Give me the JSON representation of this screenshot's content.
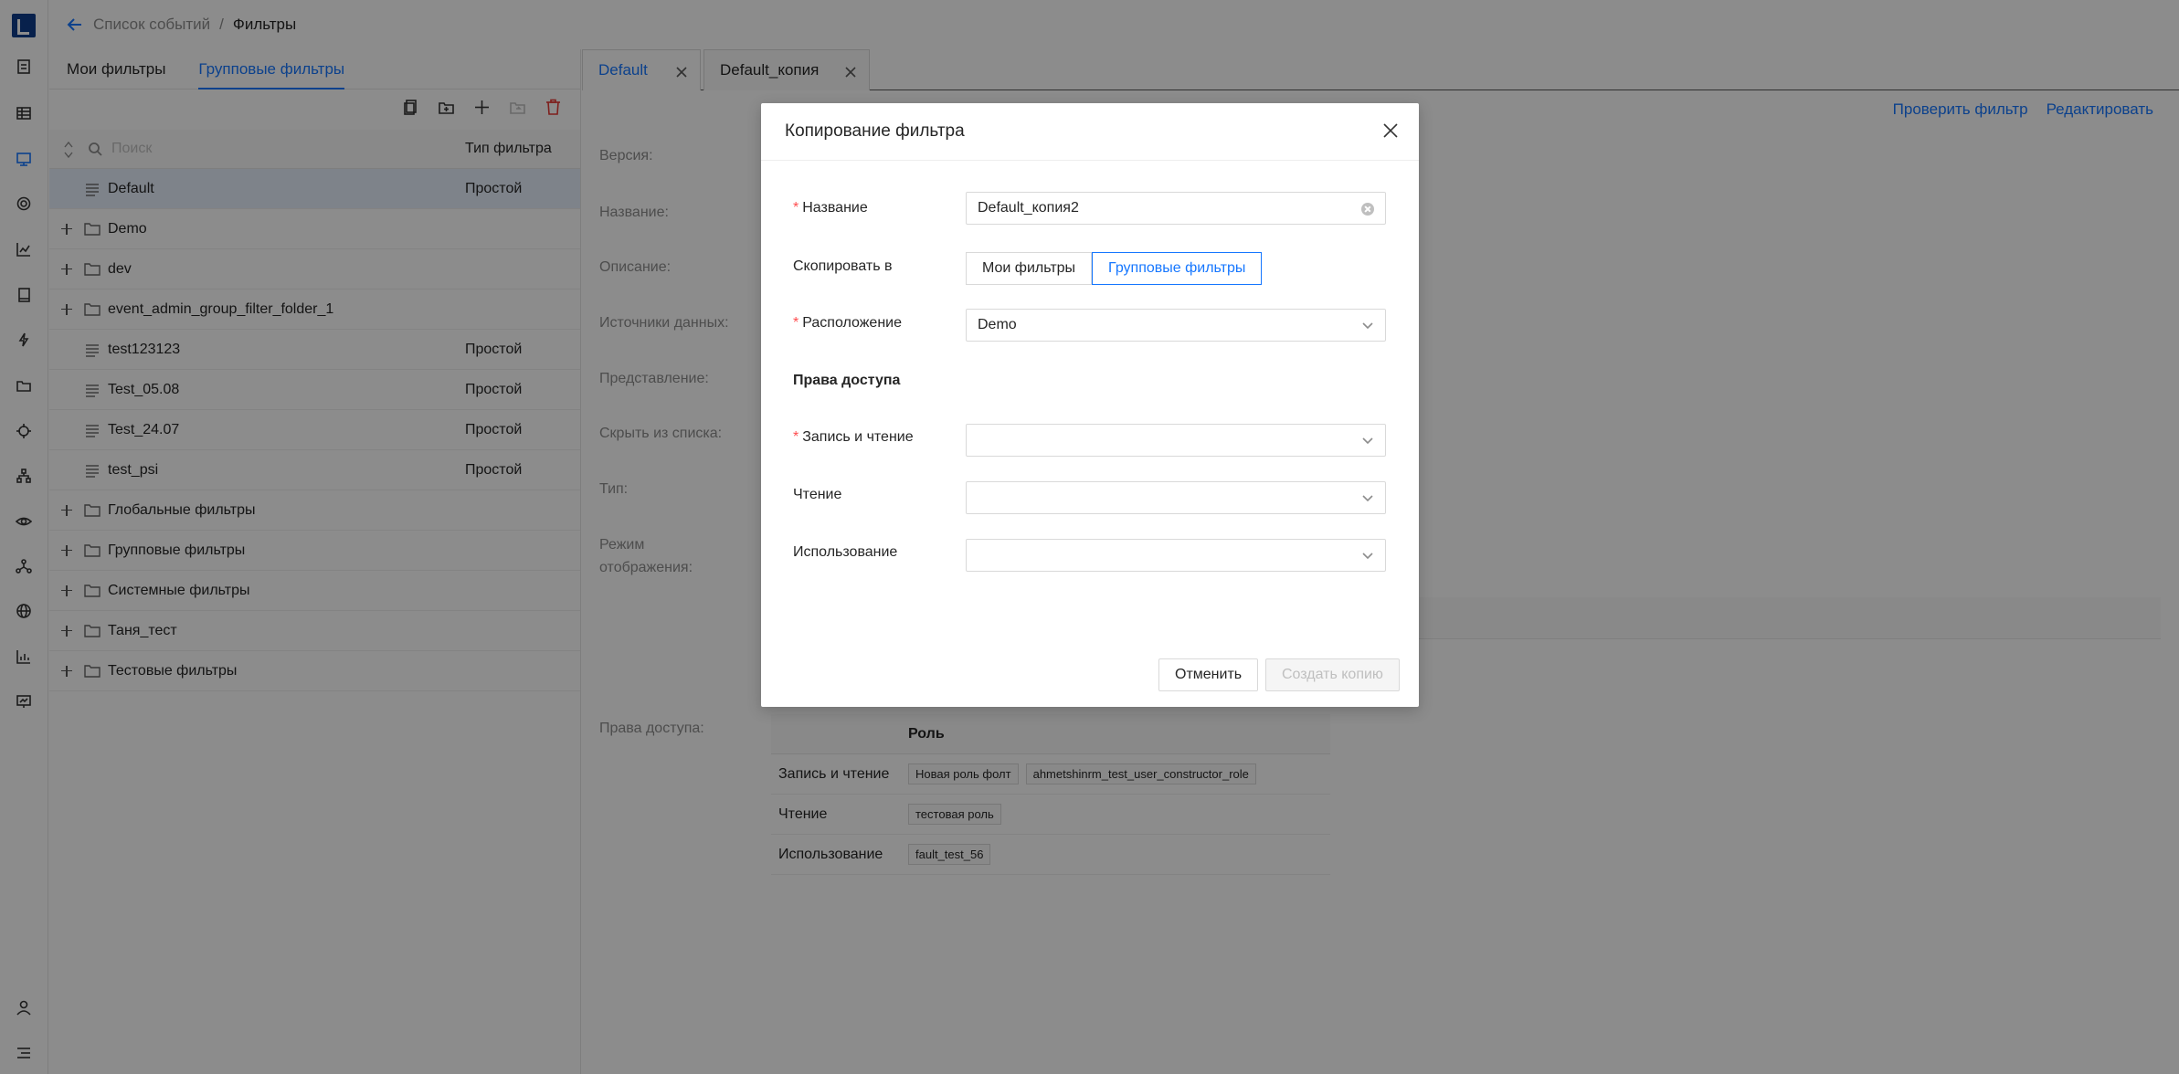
{
  "breadcrumb": {
    "parent": "Список событий",
    "current": "Фильтры"
  },
  "rail_icons": [
    "logo",
    "document-icon",
    "table-icon",
    "monitor-icon",
    "gear-icon",
    "chart-icon",
    "book-icon",
    "lightning-icon",
    "folder-icon",
    "target-icon",
    "hierarchy-icon",
    "eye-icon",
    "network-icon",
    "globe-icon",
    "bar-chart-icon",
    "presentation-icon",
    "user-icon",
    "menu-icon"
  ],
  "left": {
    "tabs": [
      "Мои фильтры",
      "Групповые фильтры"
    ],
    "active_tab": 1,
    "search_placeholder": "Поиск",
    "col_type": "Тип фильтра",
    "rows": [
      {
        "name": "Default",
        "type": "Простой",
        "kind": "filter",
        "selected": true
      },
      {
        "name": "Demo",
        "type": "",
        "kind": "folder"
      },
      {
        "name": "dev",
        "type": "",
        "kind": "folder"
      },
      {
        "name": "event_admin_group_filter_folder_1",
        "type": "",
        "kind": "folder"
      },
      {
        "name": "test123123",
        "type": "Простой",
        "kind": "filter"
      },
      {
        "name": "Test_05.08",
        "type": "Простой",
        "kind": "filter"
      },
      {
        "name": "Test_24.07",
        "type": "Простой",
        "kind": "filter"
      },
      {
        "name": "test_psi",
        "type": "Простой",
        "kind": "filter"
      },
      {
        "name": "Глобальные фильтры",
        "type": "",
        "kind": "folder"
      },
      {
        "name": "Групповые фильтры",
        "type": "",
        "kind": "folder"
      },
      {
        "name": "Системные фильтры",
        "type": "",
        "kind": "folder"
      },
      {
        "name": "Таня_тест",
        "type": "",
        "kind": "folder"
      },
      {
        "name": "Тестовые фильтры",
        "type": "",
        "kind": "folder"
      }
    ]
  },
  "right": {
    "tabs": [
      "Default",
      "Default_копия"
    ],
    "actions": {
      "check": "Проверить фильтр",
      "edit": "Редактировать"
    },
    "labels": {
      "version": "Версия:",
      "name": "Название:",
      "description": "Описание:",
      "sources": "Источники данных:",
      "view": "Представление:",
      "hide": "Скрыть из списка:",
      "type": "Тип:",
      "mode_1": "Режим",
      "mode_2": "отображения:",
      "access": "Права доступа:"
    },
    "access_table": {
      "header": "Роль",
      "rows": [
        {
          "label": "Запись и чтение",
          "tags": [
            "Новая роль фолт",
            "ahmetshinrm_test_user_constructor_role"
          ]
        },
        {
          "label": "Чтение",
          "tags": [
            "тестовая роль"
          ]
        },
        {
          "label": "Использование",
          "tags": [
            "fault_test_56"
          ]
        }
      ]
    }
  },
  "modal": {
    "title": "Копирование фильтра",
    "name_label": "Название",
    "name_value": "Default_копия2",
    "copy_to_label": "Скопировать в",
    "copy_to_options": [
      "Мои фильтры",
      "Групповые фильтры"
    ],
    "location_label": "Расположение",
    "location_value": "Demo",
    "access_heading": "Права доступа",
    "rw_label": "Запись и чтение",
    "read_label": "Чтение",
    "use_label": "Использование",
    "cancel": "Отменить",
    "create": "Создать копию",
    "required_mark": "*"
  }
}
